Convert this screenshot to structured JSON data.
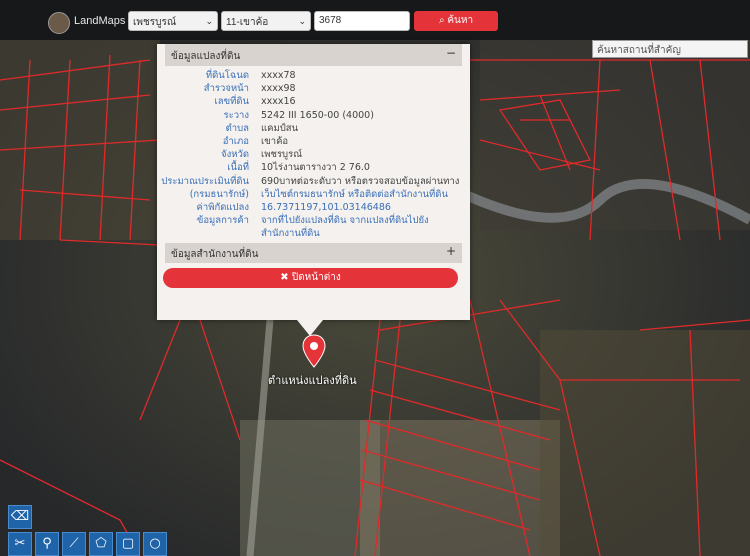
{
  "header": {
    "brand": "LandMaps",
    "province": "เพชรบูรณ์",
    "district": "11-เขาค้อ",
    "parcel_no": "3678",
    "search_label": "ค้นหา",
    "search_icon": "search-icon"
  },
  "place_search": {
    "placeholder": "ค้นหาสถานที่สำคัญ"
  },
  "popup": {
    "title": "ข้อมูลแปลงที่ดิน",
    "collapse_icon": "minus-icon",
    "rows": [
      {
        "label": "ที่ดินโฉนด",
        "value": "xxxx78"
      },
      {
        "label": "สำรวจหน้า",
        "value": "xxxx98"
      },
      {
        "label": "เลขที่ดิน",
        "value": "xxxx16"
      },
      {
        "label": "ระวาง",
        "value": "5242 III 1650-00 (4000)"
      },
      {
        "label": "ตำบล",
        "value": "แคมป์สน"
      },
      {
        "label": "อำเภอ",
        "value": "เขาค้อ"
      },
      {
        "label": "จังหวัด",
        "value": "เพชรบูรณ์"
      },
      {
        "label": "เนื้อที่",
        "value": "10ไร่งานตารางวา 2 76.0"
      },
      {
        "label": "ประมาณประเมินที่ดิน",
        "value": "690บาทต่อระดับวา หรือตรวจสอบข้อมูลผ่านทาง"
      },
      {
        "label": "(กรมธนารักษ์)",
        "value": "เว็บไซต์กรมธนารักษ์ หรือติดต่อสำนักงานที่ดิน",
        "link": true
      },
      {
        "label": "ค่าพิกัดแปลง",
        "value": "16.7371197,101.03146486",
        "link": true
      },
      {
        "label": "ข้อมูลการค้า",
        "value": "จากที่ไปยังแปลงที่ดิน จากแปลงที่ดินไปยัง",
        "link": true
      },
      {
        "label": "",
        "value": "สำนักงานที่ดิน",
        "link": true
      }
    ],
    "office_section": "ข้อมูลสำนักงานที่ดิน",
    "expand_icon": "plus-icon",
    "close_label": "ปิดหน้าต่าง",
    "close_icon": "close-icon"
  },
  "marker_label": "ตำแหน่งแปลงที่ดิน",
  "tools": [
    "eraser-icon",
    "marker-icon",
    "polyline-icon",
    "polygon-icon",
    "rectangle-icon",
    "circle-icon",
    "scissors-icon"
  ],
  "colors": {
    "accent": "#e4343a",
    "label_blue": "#3a6fb8",
    "parcel_line": "#e02a2a",
    "toolbar": "#1f63a8"
  }
}
